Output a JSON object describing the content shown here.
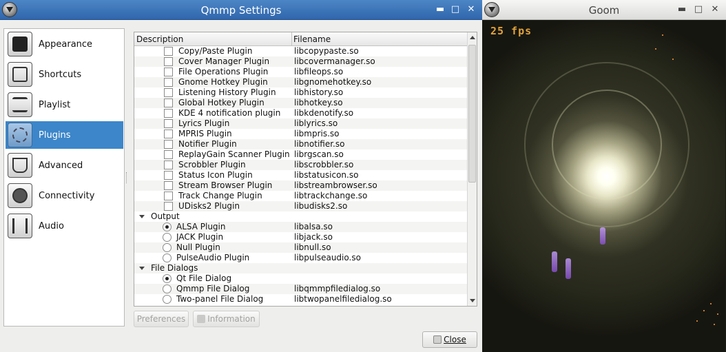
{
  "settings_window": {
    "title": "Qmmp Settings",
    "buttons": {
      "minimize": "▬",
      "maximize": "□",
      "close": "✕"
    },
    "sidebar": [
      {
        "label": "Appearance",
        "icon": "appearance-icon",
        "selected": false
      },
      {
        "label": "Shortcuts",
        "icon": "shortcuts-icon",
        "selected": false
      },
      {
        "label": "Playlist",
        "icon": "playlist-icon",
        "selected": false
      },
      {
        "label": "Plugins",
        "icon": "plugins-icon",
        "selected": true
      },
      {
        "label": "Advanced",
        "icon": "advanced-icon",
        "selected": false
      },
      {
        "label": "Connectivity",
        "icon": "connectivity-icon",
        "selected": false
      },
      {
        "label": "Audio",
        "icon": "audio-icon",
        "selected": false
      }
    ],
    "table": {
      "headers": {
        "description": "Description",
        "filename": "Filename"
      },
      "rows": [
        {
          "type": "check",
          "desc": "Copy/Paste Plugin",
          "file": "libcopypaste.so"
        },
        {
          "type": "check",
          "desc": "Cover Manager Plugin",
          "file": "libcovermanager.so"
        },
        {
          "type": "check",
          "desc": "File Operations Plugin",
          "file": "libfileops.so"
        },
        {
          "type": "check",
          "desc": "Gnome Hotkey Plugin",
          "file": "libgnomehotkey.so"
        },
        {
          "type": "check",
          "desc": "Listening History Plugin",
          "file": "libhistory.so"
        },
        {
          "type": "check",
          "desc": "Global Hotkey Plugin",
          "file": "libhotkey.so"
        },
        {
          "type": "check",
          "desc": "KDE 4 notification plugin",
          "file": "libkdenotify.so"
        },
        {
          "type": "check",
          "desc": "Lyrics Plugin",
          "file": "liblyrics.so"
        },
        {
          "type": "check",
          "desc": "MPRIS Plugin",
          "file": "libmpris.so"
        },
        {
          "type": "check",
          "desc": "Notifier Plugin",
          "file": "libnotifier.so"
        },
        {
          "type": "check",
          "desc": "ReplayGain Scanner Plugin",
          "file": "librgscan.so"
        },
        {
          "type": "check",
          "desc": "Scrobbler Plugin",
          "file": "libscrobbler.so"
        },
        {
          "type": "check",
          "desc": "Status Icon Plugin",
          "file": "libstatusicon.so"
        },
        {
          "type": "check",
          "desc": "Stream Browser Plugin",
          "file": "libstreambrowser.so"
        },
        {
          "type": "check",
          "desc": "Track Change Plugin",
          "file": "libtrackchange.so"
        },
        {
          "type": "check",
          "desc": "UDisks2 Plugin",
          "file": "libudisks2.so"
        },
        {
          "type": "group",
          "desc": "Output",
          "file": ""
        },
        {
          "type": "radio",
          "checked": true,
          "desc": "ALSA Plugin",
          "file": "libalsa.so"
        },
        {
          "type": "radio",
          "checked": false,
          "desc": "JACK Plugin",
          "file": "libjack.so"
        },
        {
          "type": "radio",
          "checked": false,
          "desc": "Null Plugin",
          "file": "libnull.so"
        },
        {
          "type": "radio",
          "checked": false,
          "desc": "PulseAudio Plugin",
          "file": "libpulseaudio.so"
        },
        {
          "type": "group",
          "desc": "File Dialogs",
          "file": ""
        },
        {
          "type": "radio",
          "checked": true,
          "desc": "Qt File Dialog",
          "file": ""
        },
        {
          "type": "radio",
          "checked": false,
          "desc": "Qmmp File Dialog",
          "file": "libqmmpfiledialog.so"
        },
        {
          "type": "radio",
          "checked": false,
          "desc": "Two-panel File Dialog",
          "file": "libtwopanelfiledialog.so"
        }
      ]
    },
    "preferences_label": "Preferences",
    "information_label": "Information",
    "close_label": "Close"
  },
  "goom_window": {
    "title": "Goom",
    "buttons": {
      "minimize": "▬",
      "maximize": "□",
      "close": "✕"
    },
    "fps_text": "25 fps"
  }
}
